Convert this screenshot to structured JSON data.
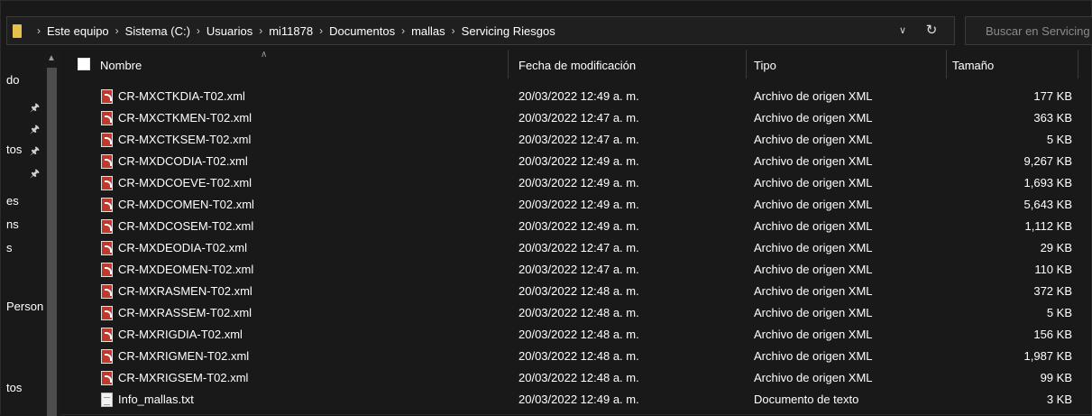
{
  "breadcrumbs": [
    "Este equipo",
    "Sistema (C:)",
    "Usuarios",
    "mi11878",
    "Documentos",
    "mallas",
    "Servicing Riesgos"
  ],
  "search": {
    "placeholder": "Buscar en Servicing Riesgos"
  },
  "nav": {
    "items": [
      "do",
      "tos",
      "es",
      "ns",
      "s",
      "Person",
      "tos"
    ]
  },
  "columns": {
    "name": "Nombre",
    "date": "Fecha de modificación",
    "type": "Tipo",
    "size": "Tamaño"
  },
  "files": [
    {
      "name": "CR-MXCTKDIA-T02.xml",
      "date": "20/03/2022 12:49 a. m.",
      "type": "Archivo de origen XML",
      "size": "177 KB",
      "icon": "xml-file-icon"
    },
    {
      "name": "CR-MXCTKMEN-T02.xml",
      "date": "20/03/2022 12:47 a. m.",
      "type": "Archivo de origen XML",
      "size": "363 KB",
      "icon": "xml-file-icon"
    },
    {
      "name": "CR-MXCTKSEM-T02.xml",
      "date": "20/03/2022 12:47 a. m.",
      "type": "Archivo de origen XML",
      "size": "5 KB",
      "icon": "xml-file-icon"
    },
    {
      "name": "CR-MXDCODIA-T02.xml",
      "date": "20/03/2022 12:49 a. m.",
      "type": "Archivo de origen XML",
      "size": "9,267 KB",
      "icon": "xml-file-icon"
    },
    {
      "name": "CR-MXDCOEVE-T02.xml",
      "date": "20/03/2022 12:49 a. m.",
      "type": "Archivo de origen XML",
      "size": "1,693 KB",
      "icon": "xml-file-icon"
    },
    {
      "name": "CR-MXDCOMEN-T02.xml",
      "date": "20/03/2022 12:49 a. m.",
      "type": "Archivo de origen XML",
      "size": "5,643 KB",
      "icon": "xml-file-icon"
    },
    {
      "name": "CR-MXDCOSEM-T02.xml",
      "date": "20/03/2022 12:49 a. m.",
      "type": "Archivo de origen XML",
      "size": "1,112 KB",
      "icon": "xml-file-icon"
    },
    {
      "name": "CR-MXDEODIA-T02.xml",
      "date": "20/03/2022 12:47 a. m.",
      "type": "Archivo de origen XML",
      "size": "29 KB",
      "icon": "xml-file-icon"
    },
    {
      "name": "CR-MXDEOMEN-T02.xml",
      "date": "20/03/2022 12:47 a. m.",
      "type": "Archivo de origen XML",
      "size": "110 KB",
      "icon": "xml-file-icon"
    },
    {
      "name": "CR-MXRASMEN-T02.xml",
      "date": "20/03/2022 12:48 a. m.",
      "type": "Archivo de origen XML",
      "size": "372 KB",
      "icon": "xml-file-icon"
    },
    {
      "name": "CR-MXRASSEM-T02.xml",
      "date": "20/03/2022 12:48 a. m.",
      "type": "Archivo de origen XML",
      "size": "5 KB",
      "icon": "xml-file-icon"
    },
    {
      "name": "CR-MXRIGDIA-T02.xml",
      "date": "20/03/2022 12:48 a. m.",
      "type": "Archivo de origen XML",
      "size": "156 KB",
      "icon": "xml-file-icon"
    },
    {
      "name": "CR-MXRIGMEN-T02.xml",
      "date": "20/03/2022 12:48 a. m.",
      "type": "Archivo de origen XML",
      "size": "1,987 KB",
      "icon": "xml-file-icon"
    },
    {
      "name": "CR-MXRIGSEM-T02.xml",
      "date": "20/03/2022 12:48 a. m.",
      "type": "Archivo de origen XML",
      "size": "99 KB",
      "icon": "xml-file-icon"
    },
    {
      "name": "Info_mallas.txt",
      "date": "20/03/2022 12:49 a. m.",
      "type": "Documento de texto",
      "size": "3 KB",
      "icon": "text-file-icon"
    }
  ],
  "colors": {
    "background": "#191919",
    "folder": "#e8c14a",
    "xml_icon": "#c0392b"
  }
}
